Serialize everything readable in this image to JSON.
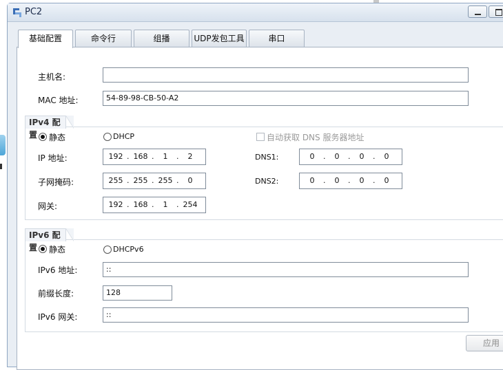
{
  "window": {
    "title": "PC2"
  },
  "tabs": [
    {
      "label": "基础配置",
      "active": true
    },
    {
      "label": "命令行",
      "active": false
    },
    {
      "label": "组播",
      "active": false
    },
    {
      "label": "UDP发包工具",
      "active": false
    },
    {
      "label": "串口",
      "active": false
    }
  ],
  "basic": {
    "hostname_label": "主机名:",
    "hostname_value": "",
    "mac_label": "MAC 地址:",
    "mac_value": "54-89-98-CB-50-A2"
  },
  "ipv4": {
    "group_title": "IPv4 配置",
    "static_label": "静态",
    "dhcp_label": "DHCP",
    "auto_dns_label": "自动获取 DNS 服务器地址",
    "ip_label": "IP 地址:",
    "ip": [
      "192",
      "168",
      "1",
      "2"
    ],
    "mask_label": "子网掩码:",
    "mask": [
      "255",
      "255",
      "255",
      "0"
    ],
    "gateway_label": "网关:",
    "gateway": [
      "192",
      "168",
      "1",
      "254"
    ],
    "dns1_label": "DNS1:",
    "dns1": [
      "0",
      "0",
      "0",
      "0"
    ],
    "dns2_label": "DNS2:",
    "dns2": [
      "0",
      "0",
      "0",
      "0"
    ]
  },
  "ipv6": {
    "group_title": "IPv6 配置",
    "static_label": "静态",
    "dhcp_label": "DHCPv6",
    "addr_label": "IPv6 地址:",
    "addr_value": "::",
    "prefix_label": "前缀长度:",
    "prefix_value": "128",
    "gateway_label": "IPv6 网关:",
    "gateway_value": "::"
  },
  "actions": {
    "apply_label": "应用"
  }
}
